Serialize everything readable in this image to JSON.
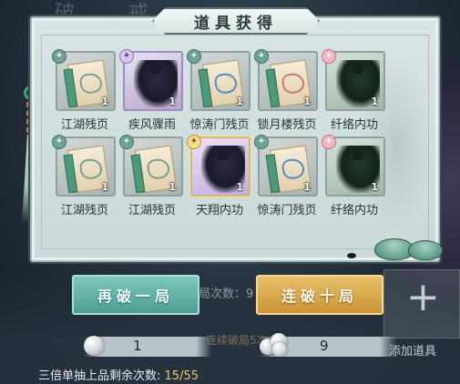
{
  "background": {
    "faded_text": "破 戒"
  },
  "dialog": {
    "title": "道具获得",
    "items": [
      {
        "name": "江湖残页",
        "qty": "1",
        "art": "scroll",
        "tint": "green",
        "frame": "grey",
        "badge": "green"
      },
      {
        "name": "疾风骤雨",
        "qty": "1",
        "art": "figure",
        "tint": "dark",
        "frame": "purple",
        "badge": "purple"
      },
      {
        "name": "惊涛门残页",
        "qty": "1",
        "art": "scroll",
        "tint": "blue",
        "frame": "grey",
        "badge": "green"
      },
      {
        "name": "锁月楼残页",
        "qty": "1",
        "art": "scroll",
        "tint": "red",
        "frame": "grey",
        "badge": "green"
      },
      {
        "name": "纤络内功",
        "qty": "1",
        "art": "figure",
        "tint": "green",
        "frame": "green",
        "badge": "pink"
      },
      {
        "name": "江湖残页",
        "qty": "1",
        "art": "scroll",
        "tint": "green",
        "frame": "grey",
        "badge": "green"
      },
      {
        "name": "江湖残页",
        "qty": "1",
        "art": "scroll",
        "tint": "green",
        "frame": "grey",
        "badge": "green"
      },
      {
        "name": "天翔内功",
        "qty": "1",
        "art": "figure",
        "tint": "dark",
        "frame": "gold",
        "badge": "gold"
      },
      {
        "name": "惊涛门残页",
        "qty": "1",
        "art": "scroll",
        "tint": "blue",
        "frame": "grey",
        "badge": "green"
      },
      {
        "name": "纤络内功",
        "qty": "1",
        "art": "figure",
        "tint": "green",
        "frame": "green",
        "badge": "pink"
      }
    ]
  },
  "actions": {
    "again_label": "再破一局",
    "ten_label": "连破十局",
    "behind_text": "局次数：9",
    "behind_text2": "连续破局5次必"
  },
  "currencies": {
    "single_value": "1",
    "multi_value": "9"
  },
  "add_item": {
    "label": "添加道具",
    "icon": "plus-icon"
  },
  "footer": {
    "label": "三倍单抽上品剩余次数:",
    "count": "15/55"
  },
  "colors": {
    "again_button": "#5fb0a5",
    "ten_button": "#dba94c",
    "count_highlight": "#e9c36a"
  }
}
